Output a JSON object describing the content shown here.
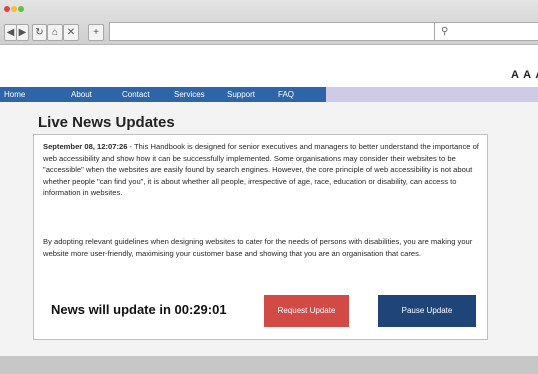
{
  "browser": {
    "back_glyph": "◀",
    "forward_glyph": "▶",
    "reload_glyph": "↻",
    "home_glyph": "⌂",
    "close_glyph": "✕",
    "newtab_glyph": "+",
    "search_glyph": "⚲",
    "colors": {
      "close": "#e0443e",
      "minimize": "#f4bf34",
      "maximize": "#5fc242"
    }
  },
  "header": {
    "text_size_label": "A A A"
  },
  "nav": {
    "items": [
      {
        "label": "Home"
      },
      {
        "label": "About"
      },
      {
        "label": "Contact"
      },
      {
        "label": "Services"
      },
      {
        "label": "Support"
      },
      {
        "label": "FAQ"
      }
    ]
  },
  "main": {
    "title": "Live News Updates",
    "news_timestamp": "September 08, 12:07:26",
    "news_p1": " - This Handbook is designed for senior executives and managers to better understand the importance of web accessibility and show how it can be successfully implemented. Some organisations may consider their websites to be \"accessible\" when the websites are easily found by search engines. However, the core principle of web accessibility is not about whether people \"can find you\", it is about whether all people, irrespective of age, race, education or disability, can access to information in websites.",
    "news_p2": "By adopting relevant guidelines when designing websites to cater for the needs of persons with disabilities, you are making your website more user-friendly, maximising your customer base and showing that you are an organisation that cares.",
    "countdown": "News will update in 00:29:01",
    "request_label": "Request Update",
    "pause_label": "Pause Update",
    "colors": {
      "request": "#d14a46",
      "pause": "#1f4478",
      "nav": "#2d65a8"
    }
  }
}
